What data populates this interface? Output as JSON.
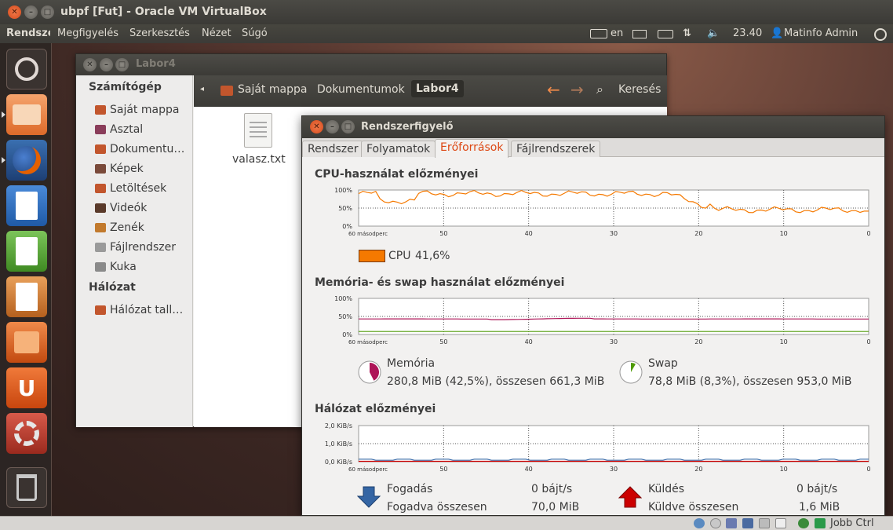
{
  "vbox": {
    "title": "ubpf [Fut] - Oracle VM VirtualBox",
    "host_key": "Jobb Ctrl"
  },
  "panel": {
    "app_name": "Rendszerfigyelő",
    "menus": [
      "Megfigyelés",
      "Szerkesztés",
      "Nézet",
      "Súgó"
    ],
    "keyboard_layout": "en",
    "clock": "23.40",
    "user": "Matinfo Admin"
  },
  "launcher": [
    "dash-home",
    "files",
    "firefox",
    "writer",
    "calc",
    "impress",
    "software-center",
    "ubuntu-one",
    "system-settings",
    "trash"
  ],
  "nautilus": {
    "title": "Labor4",
    "sidebar": {
      "computer_heading": "Számítógép",
      "computer_items": [
        {
          "label": "Saját mappa",
          "color": "#c2562d"
        },
        {
          "label": "Asztal",
          "color": "#8a3d5a"
        },
        {
          "label": "Dokumentu…",
          "color": "#c2562d"
        },
        {
          "label": "Képek",
          "color": "#7a4a3a"
        },
        {
          "label": "Letöltések",
          "color": "#c2562d"
        },
        {
          "label": "Videók",
          "color": "#5a3a2a"
        },
        {
          "label": "Zenék",
          "color": "#c27a2d"
        },
        {
          "label": "Fájlrendszer",
          "color": "#9a9a9a"
        },
        {
          "label": "Kuka",
          "color": "#8a8a8a"
        }
      ],
      "network_heading": "Hálózat",
      "network_items": [
        {
          "label": "Hálózat tall…",
          "color": "#c2562d"
        }
      ]
    },
    "pathbar": {
      "crumbs": [
        "Saját mappa",
        "Dokumentumok",
        "Labor4"
      ],
      "search_label": "Keresés"
    },
    "files": [
      {
        "name": "valasz.txt"
      }
    ]
  },
  "sysmon": {
    "title": "Rendszerfigyelő",
    "tabs": [
      "Rendszer",
      "Folyamatok",
      "Erőforrások",
      "Fájlrendszerek"
    ],
    "active_tab": "Erőforrások",
    "x_ticks": [
      "60 másodperc",
      "50",
      "40",
      "30",
      "20",
      "10",
      "0"
    ],
    "cpu": {
      "heading": "CPU-használat előzményei",
      "y_ticks": [
        "100%",
        "50%",
        "0%"
      ],
      "legend": "CPU",
      "value": "41,6%",
      "color": "#f57900"
    },
    "memory": {
      "heading": "Memória- és swap használat előzményei",
      "y_ticks": [
        "100%",
        "50%",
        "0%"
      ],
      "mem_label": "Memória",
      "mem_value": "280,8 MiB (42,5%), összesen 661,3 MiB",
      "mem_color": "#ad1457",
      "mem_fraction": 0.425,
      "swap_label": "Swap",
      "swap_value": "78,8 MiB (8,3%), összesen 953,0 MiB",
      "swap_color": "#4e9a06",
      "swap_fraction": 0.083
    },
    "network": {
      "heading": "Hálózat előzményei",
      "y_ticks": [
        "2,0 KiB/s",
        "1,0 KiB/s",
        "0,0 KiB/s"
      ],
      "recv_label": "Fogadás",
      "recv_value": "0 bájt/s",
      "recv_total_label": "Fogadva összesen",
      "recv_total_value": "70,0 MiB",
      "send_label": "Küldés",
      "send_value": "0 bájt/s",
      "send_total_label": "Küldve összesen",
      "send_total_value": "1,6 MiB",
      "recv_color": "#3465a4",
      "send_color": "#cc0000"
    }
  }
}
